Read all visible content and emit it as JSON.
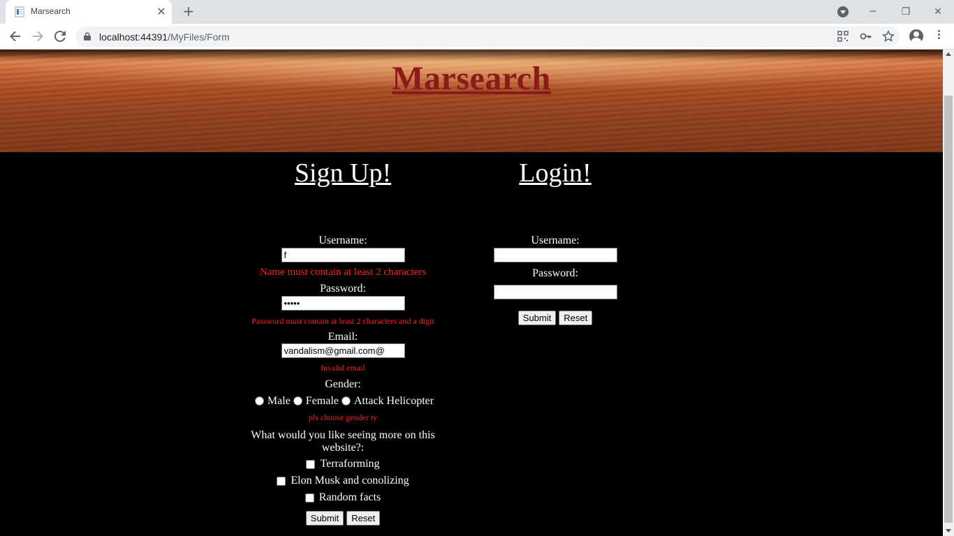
{
  "browser": {
    "tab_title": "Marsearch",
    "url_host": "localhost:44391",
    "url_path": "/MyFiles/Form"
  },
  "page": {
    "site_title": "Marsearch"
  },
  "signup": {
    "heading": "Sign Up!",
    "username_label": "Username:",
    "username_value": "f",
    "username_error": "Name must contain at least 2 characters",
    "password_label": "Password:",
    "password_value": "•••••",
    "password_error": "Password must contain at least 2 characters and a digit",
    "email_label": "Email:",
    "email_value": "vandalism@gmail.com@",
    "email_error": "Invalid email",
    "gender_label": "Gender:",
    "gender_options": [
      "Male",
      "Female",
      "Attack Helicopter"
    ],
    "gender_error": "pls choose gender ty",
    "interests_label": "What would you like seeing more on this website?:",
    "interests": [
      "Terraforming",
      "Elon Musk and conolizing",
      "Random facts"
    ],
    "submit_label": "Submit",
    "reset_label": "Reset"
  },
  "login": {
    "heading": "Login!",
    "username_label": "Username:",
    "username_value": "",
    "password_label": "Password:",
    "password_value": "",
    "submit_label": "Submit",
    "reset_label": "Reset"
  },
  "colors": {
    "title": "#8b1a1a",
    "error": "#ff1f1f",
    "background": "#000000"
  }
}
